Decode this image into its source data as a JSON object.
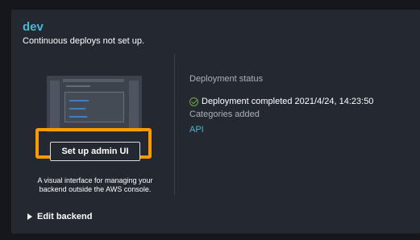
{
  "environment": {
    "name": "dev",
    "subtitle": "Continuous deploys not set up."
  },
  "admin_ui": {
    "button_label": "Set up admin UI",
    "description": "A visual interface for managing your backend outside the AWS console."
  },
  "edit_backend": {
    "label": "Edit backend"
  },
  "deployment": {
    "status_label": "Deployment status",
    "status_text": "Deployment completed 2021/4/24, 14:23:50"
  },
  "categories": {
    "label": "Categories added",
    "items": [
      "API"
    ]
  },
  "colors": {
    "accent": "#44b9d6",
    "highlight": "#ff9900",
    "success": "#6aaf35",
    "card_bg": "#232831"
  }
}
